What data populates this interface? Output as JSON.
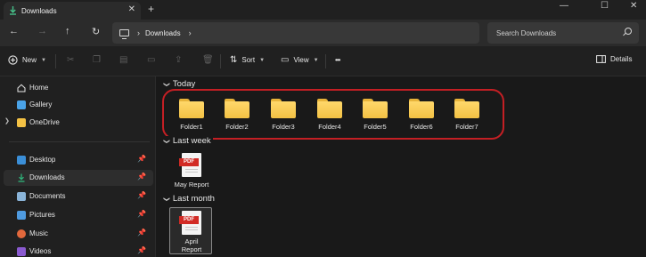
{
  "titlebar": {
    "tab_title": "Downloads",
    "tab_close": "✕",
    "new_tab": "+",
    "minimize": "—",
    "maximize": "☐",
    "close": "✕"
  },
  "nav": {
    "back": "←",
    "forward": "→",
    "up": "↑",
    "refresh": "↻"
  },
  "address": {
    "chevron": "›",
    "crumb": "Downloads",
    "crumb_chevron": "›"
  },
  "search": {
    "placeholder": "Search Downloads"
  },
  "commands": {
    "new_label": "New",
    "sort_label": "Sort",
    "view_label": "View",
    "more": "•••",
    "details_label": "Details"
  },
  "sidebar": {
    "items": [
      {
        "label": "Home",
        "color": "#e8e8e8"
      },
      {
        "label": "Gallery",
        "color": "#4aa3e8"
      },
      {
        "label": "OneDrive",
        "color": "#f3c144"
      },
      {
        "label": "Desktop",
        "color": "#3b8fd8"
      },
      {
        "label": "Downloads",
        "color": "#2fb37a"
      },
      {
        "label": "Documents",
        "color": "#8ab4d8"
      },
      {
        "label": "Pictures",
        "color": "#4f9be0"
      },
      {
        "label": "Music",
        "color": "#e2683c"
      },
      {
        "label": "Videos",
        "color": "#8a5ad0"
      }
    ]
  },
  "content": {
    "groups": {
      "today": "Today",
      "last_week": "Last week",
      "last_month": "Last month"
    },
    "folders": [
      "Folder1",
      "Folder2",
      "Folder3",
      "Folder4",
      "Folder5",
      "Folder6",
      "Folder7"
    ],
    "files": {
      "last_week": {
        "name": "May Report",
        "badge": "PDF"
      },
      "last_month": {
        "name_line1": "April",
        "name_line2": "Report",
        "badge": "PDF"
      }
    },
    "highlight_color": "#c41f24"
  }
}
